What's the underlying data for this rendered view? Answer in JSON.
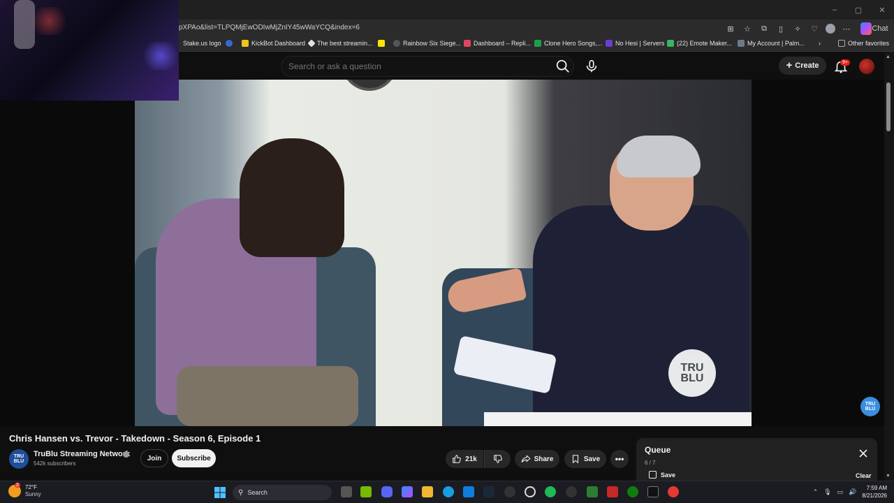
{
  "browser": {
    "url": "pXPAo&list=TLPQMjEwODIwMjZnIY45wWaYCQ&index=6",
    "chat_label": "Chat",
    "window_controls": [
      "–",
      "▢",
      "✕"
    ]
  },
  "bookmarks": [
    {
      "label": "Stake.us logo",
      "color": "#1f2b3a"
    },
    {
      "label": "",
      "color": "#3867d6"
    },
    {
      "label": "KickBot Dashboard",
      "color": "#f0c419"
    },
    {
      "label": "The best streamin...",
      "color": "#e0e0e0"
    },
    {
      "label": "",
      "color": "#f7e600"
    },
    {
      "label": "Rainbow Six Siege...",
      "color": "#555"
    },
    {
      "label": "Dashboard – Repli...",
      "color": "#e2445c"
    },
    {
      "label": "Clone Hero Songs,...",
      "color": "#1e9e4a"
    },
    {
      "label": "No Hesi | Servers",
      "color": "#6b3dd6"
    },
    {
      "label": "(22) Emote Maker...",
      "color": "#35b566"
    },
    {
      "label": "My Account | Palm...",
      "color": "#6a7b8c"
    },
    {
      "label": "Other favorites",
      "color": "#aaa"
    }
  ],
  "header": {
    "search_placeholder": "Search or ask a question",
    "create_label": "Create",
    "notifications": "9+"
  },
  "video": {
    "watermark": "TRU BLU",
    "channel_watermark": "TRU BLU",
    "title": "Chris Hansen vs. Trevor - Takedown - Season 6, Episode 1"
  },
  "channel": {
    "avatar_text": "TRU BLU",
    "name": "TruBlu Streaming Network",
    "subscribers": "542k subscribers",
    "join_label": "Join",
    "subscribe_label": "Subscribe"
  },
  "actions": {
    "likes": "21k",
    "share_label": "Share",
    "save_label": "Save"
  },
  "queue": {
    "title": "Queue",
    "position": "6 / 7",
    "save_label": "Save",
    "clear_label": "Clear"
  },
  "taskbar": {
    "temperature": "72°F",
    "condition": "Sunny",
    "weather_badge": "2",
    "search_label": "Search",
    "time": "7:59 AM",
    "date": "8/21/2026"
  }
}
